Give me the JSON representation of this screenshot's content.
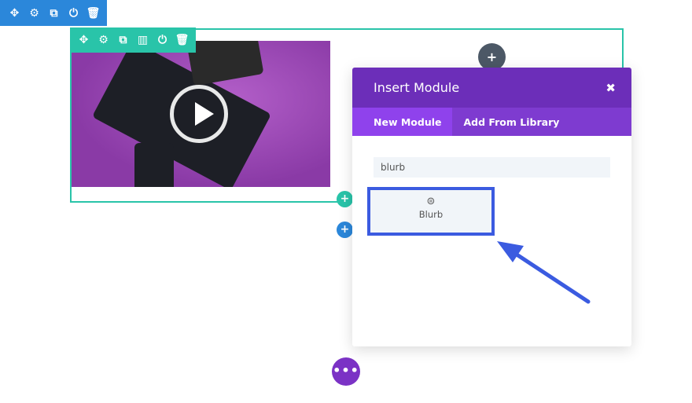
{
  "section_toolbar": {
    "icons": [
      "move-icon",
      "gear-icon",
      "duplicate-icon",
      "power-icon",
      "trash-icon"
    ],
    "color": "#2b87da"
  },
  "row_toolbar": {
    "icons": [
      "move-icon",
      "gear-icon",
      "duplicate-icon",
      "columns-icon",
      "power-icon",
      "trash-icon"
    ],
    "color": "#29c4a9"
  },
  "modal": {
    "title": "Insert Module",
    "close": "✖",
    "tabs": [
      {
        "label": "New Module",
        "active": true
      },
      {
        "label": "Add From Library",
        "active": false
      }
    ],
    "search_value": "blurb",
    "results": [
      {
        "label": "Blurb",
        "icon": "blurb-icon"
      }
    ],
    "header_color": "#6c2eb9"
  },
  "highlight_color": "#3b5be0"
}
